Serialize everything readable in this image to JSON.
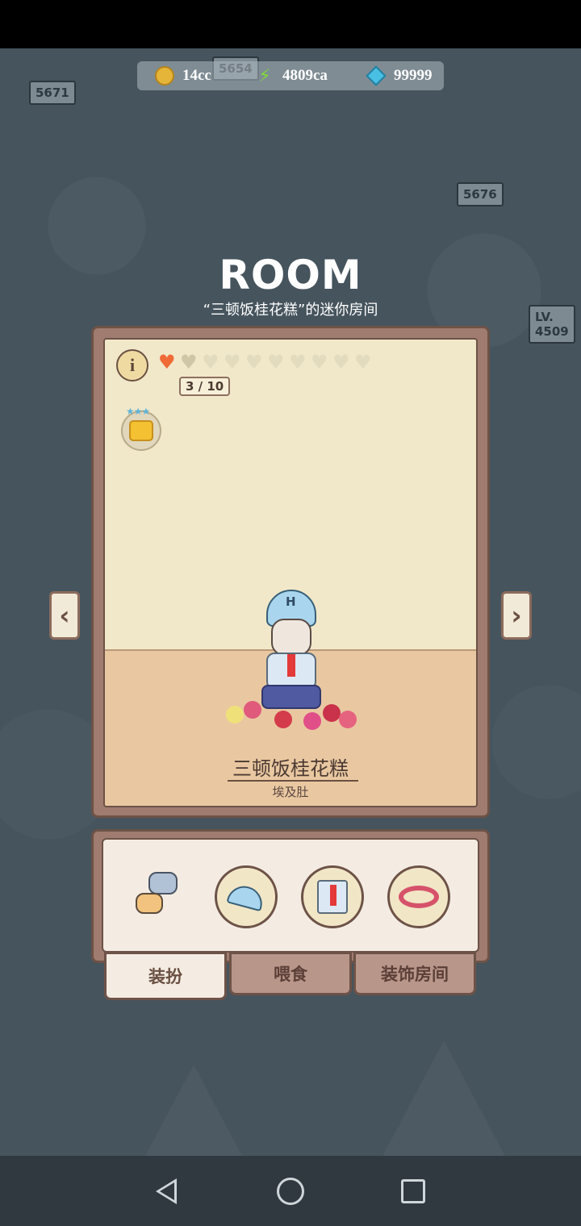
{
  "resources": [
    {
      "icon": "coin-icon",
      "value": "14cc"
    },
    {
      "icon": "energy-bolt-icon",
      "value": "4809ca"
    },
    {
      "icon": "gem-icon",
      "value": "99999"
    }
  ],
  "background_signs": [
    "5654",
    "5671",
    "5676",
    "4509",
    "LV."
  ],
  "header": {
    "title": "ROOM",
    "subtitle": "“三顿饭桂花糕”的迷你房间"
  },
  "room": {
    "hearts_filled": 1,
    "hearts_half": 1,
    "hearts_total": 10,
    "heart_count": "3 / 10",
    "character_name": "三顿饭桂花糕",
    "character_breed": "埃及肚"
  },
  "outfit_slots": [
    {
      "icon": "swap-cats-icon"
    },
    {
      "icon": "baseball-cap-icon"
    },
    {
      "icon": "shirt-tie-icon"
    },
    {
      "icon": "flower-wreath-icon"
    }
  ],
  "tabs": {
    "dress": "装扮",
    "feed": "喂食",
    "decorate": "装饰房间"
  },
  "colors": {
    "heart_full": "#ef6a35",
    "panel_brown": "#9f7c6f",
    "wall": "#f1e8c9",
    "floor": "#e9c8a1"
  }
}
